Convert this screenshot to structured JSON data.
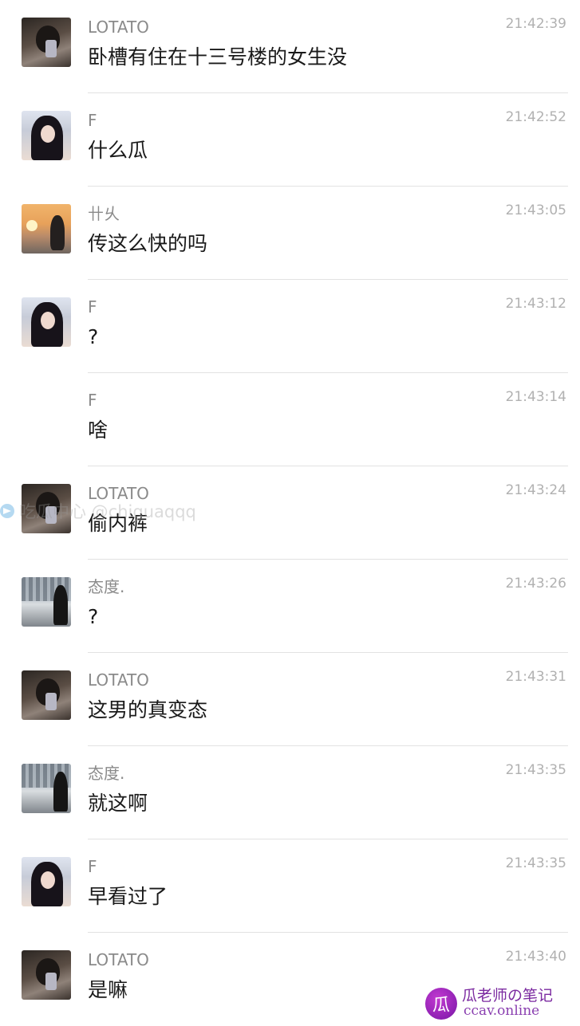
{
  "messages": [
    {
      "name": "LOTATO",
      "time": "21:42:39",
      "text": "卧槽有住在十三号楼的女生没",
      "avatar": "lotato"
    },
    {
      "name": "F",
      "time": "21:42:52",
      "text": "什么瓜",
      "avatar": "f"
    },
    {
      "name": "卄乆",
      "time": "21:43:05",
      "text": "传这么快的吗",
      "avatar": "sunset"
    },
    {
      "name": "F",
      "time": "21:43:12",
      "text": "?",
      "avatar": "f"
    },
    {
      "name": "F",
      "time": "21:43:14",
      "text": "啥",
      "avatar": "none"
    },
    {
      "name": "LOTATO",
      "time": "21:43:24",
      "text": "偷内裤",
      "avatar": "lotato"
    },
    {
      "name": "态度.",
      "time": "21:43:26",
      "text": "?",
      "avatar": "taidu"
    },
    {
      "name": "LOTATO",
      "time": "21:43:31",
      "text": "这男的真变态",
      "avatar": "lotato"
    },
    {
      "name": "态度.",
      "time": "21:43:35",
      "text": "就这啊",
      "avatar": "taidu"
    },
    {
      "name": "F",
      "time": "21:43:35",
      "text": "早看过了",
      "avatar": "f"
    },
    {
      "name": "LOTATO",
      "time": "21:43:40",
      "text": "是嘛",
      "avatar": "lotato"
    }
  ],
  "watermark": {
    "text": "吃瓜中心 @chiguaqqq",
    "icon": "telegram-icon"
  },
  "logo": {
    "badge": "瓜",
    "title": "瓜老师の笔记",
    "subtitle": "ccav.online"
  }
}
